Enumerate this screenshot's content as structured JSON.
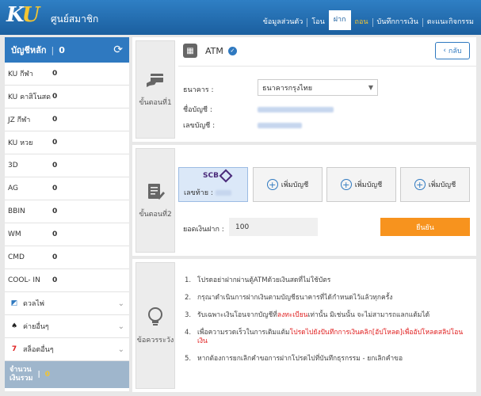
{
  "header": {
    "logo_k": "K",
    "logo_u": "U",
    "title": "ศูนย์สมาชิก",
    "nav": [
      {
        "label": "ข้อมูลส่วนตัว",
        "state": "normal"
      },
      {
        "label": "โอน",
        "state": "normal"
      },
      {
        "label": "ฝาก",
        "state": "current"
      },
      {
        "label": "ถอน",
        "state": "active"
      },
      {
        "label": "บันทึกการเงิน",
        "state": "normal"
      },
      {
        "label": "ตะแนะกิจกรรม",
        "state": "normal"
      }
    ]
  },
  "sidebar": {
    "main_account_label": "บัญชีหลัก",
    "main_account_value": "0",
    "refresh_icon": "refresh-icon",
    "rows": [
      {
        "label": "KU กีฬา",
        "value": "0"
      },
      {
        "label": "KU คาสิโนสด",
        "value": "0"
      },
      {
        "label": "JZ กีฬา",
        "value": "0"
      },
      {
        "label": "KU หวย",
        "value": "0"
      },
      {
        "label": "3D",
        "value": "0"
      },
      {
        "label": "AG",
        "value": "0"
      },
      {
        "label": "BBIN",
        "value": "0"
      },
      {
        "label": "WM",
        "value": "0"
      },
      {
        "label": "CMD",
        "value": "0"
      },
      {
        "label": "COOL- IN",
        "value": "0"
      }
    ],
    "expanders": [
      {
        "label": "ดวลไพ่",
        "icon": "cards-icon"
      },
      {
        "label": "ค่ายอื่นๆ",
        "icon": "spade-icon"
      },
      {
        "label": "สล็อตอื่นๆ",
        "icon": "seven-icon"
      }
    ],
    "total_label_1": "จำนวน",
    "total_label_2": "เงินรวม",
    "total_value": "0"
  },
  "step1": {
    "label": "ขั้นตอนที่1",
    "method": "ATM",
    "back_label": "กลับ",
    "bank_label": "ธนาคาร :",
    "bank_value": "ธนาคารกรุงไทย",
    "account_name_label": "ชื่อบัญชี :",
    "account_number_label": "เลขบัญชี :"
  },
  "step2": {
    "label": "ขั้นตอนที่2",
    "scb_brand": "SCB",
    "last_digits_label": "เลขท้าย :",
    "add_account_label": "เพิ่มบัญชี",
    "amount_label": "ยอดเงินฝาก :",
    "amount_value": "100",
    "confirm_label": "ยืนยัน"
  },
  "step3": {
    "label": "ข้อควรระวัง",
    "notes": [
      {
        "num": "1.",
        "parts": [
          {
            "t": "โปรดอย่าฝากผ่านตู้ATMด้วยเงินสดที่ไม่ใช้บัตร",
            "red": false
          }
        ]
      },
      {
        "num": "2.",
        "parts": [
          {
            "t": "กรุณาดำเนินการฝากเงินตามบัญชีธนาคารที่ได้กำหนดไว้แล้วทุกครั้ง",
            "red": false
          }
        ]
      },
      {
        "num": "3.",
        "parts": [
          {
            "t": "รับเฉพาะเงินโอนจากบัญชีที่",
            "red": false
          },
          {
            "t": "ลงทะเบียน",
            "red": true
          },
          {
            "t": "เท่านั้น มิเช่นนั้น จะไม่สามารถแลกแต้มได้",
            "red": false
          }
        ]
      },
      {
        "num": "4.",
        "parts": [
          {
            "t": "เพื่อความรวดเร็วในการเติมแต้ม",
            "red": false
          },
          {
            "t": "โปรดไปยังปันทึกการเงินคลิก[อัปโหลด]เพื่ออัปโหลดสลิปโอนเงิน",
            "red": true
          }
        ]
      },
      {
        "num": "5.",
        "parts": [
          {
            "t": "หากต้องการยกเลิกคำขอการฝากโปรดไปที่บันทึกธุรกรรม - ยกเลิกคำขอ",
            "red": false
          }
        ]
      }
    ]
  }
}
